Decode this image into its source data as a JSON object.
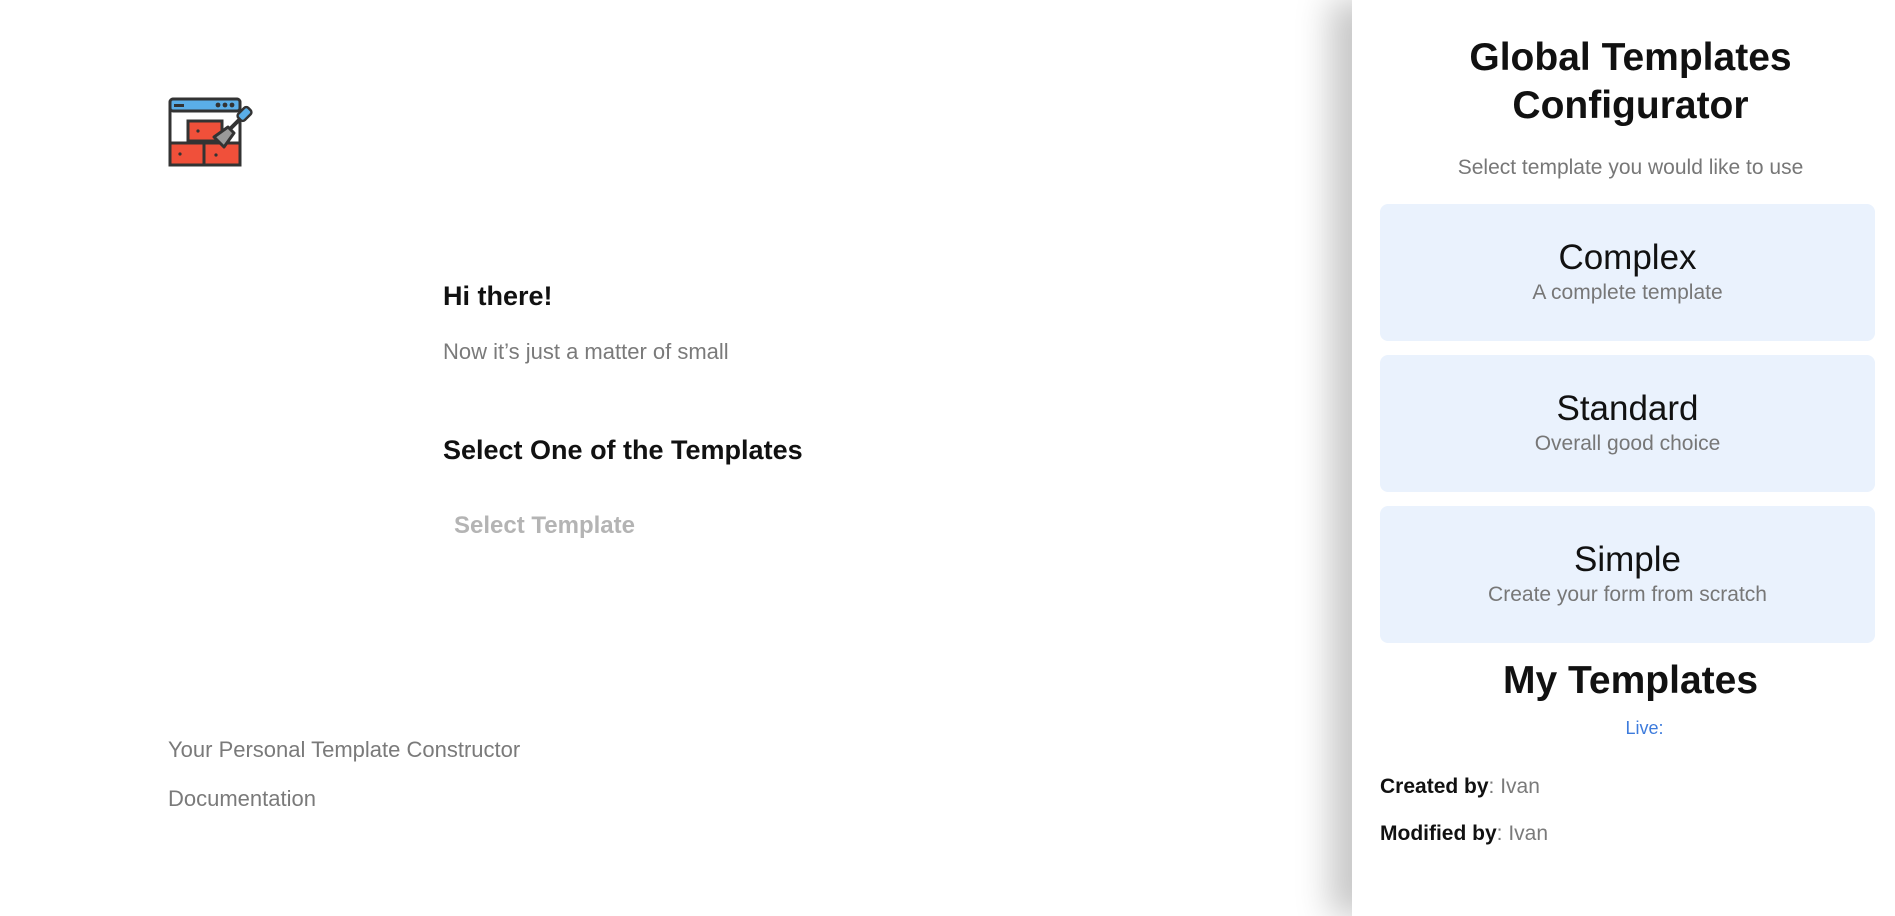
{
  "main": {
    "greeting": "Hi there!",
    "subtitle": "Now it’s just a matter of small",
    "select_heading": "Select One of the Templates",
    "select_button": "Select Template"
  },
  "footer": {
    "links": [
      {
        "label": "Your Personal Template Constructor"
      },
      {
        "label": "Documentation"
      }
    ]
  },
  "panel": {
    "title_line1": "Global Templates",
    "title_line2": "Configurator",
    "subtitle": "Select template you would like to use",
    "templates": [
      {
        "title": "Complex",
        "desc": "A complete template"
      },
      {
        "title": "Standard",
        "desc": "Overall good choice"
      },
      {
        "title": "Simple",
        "desc": "Create your form from scratch"
      }
    ],
    "my_templates_title": "My Templates",
    "live_label": "Live:",
    "created_label": "Created by",
    "created_value": ": Ivan",
    "modified_label": "Modified by",
    "modified_value": ": Ivan"
  },
  "icons": {
    "logo": "template-builder-logo-icon"
  },
  "colors": {
    "card_bg": "#eaf2fd",
    "link_blue": "#3d7bdc",
    "brick_red": "#f0503a",
    "window_blue": "#5aaee8"
  }
}
